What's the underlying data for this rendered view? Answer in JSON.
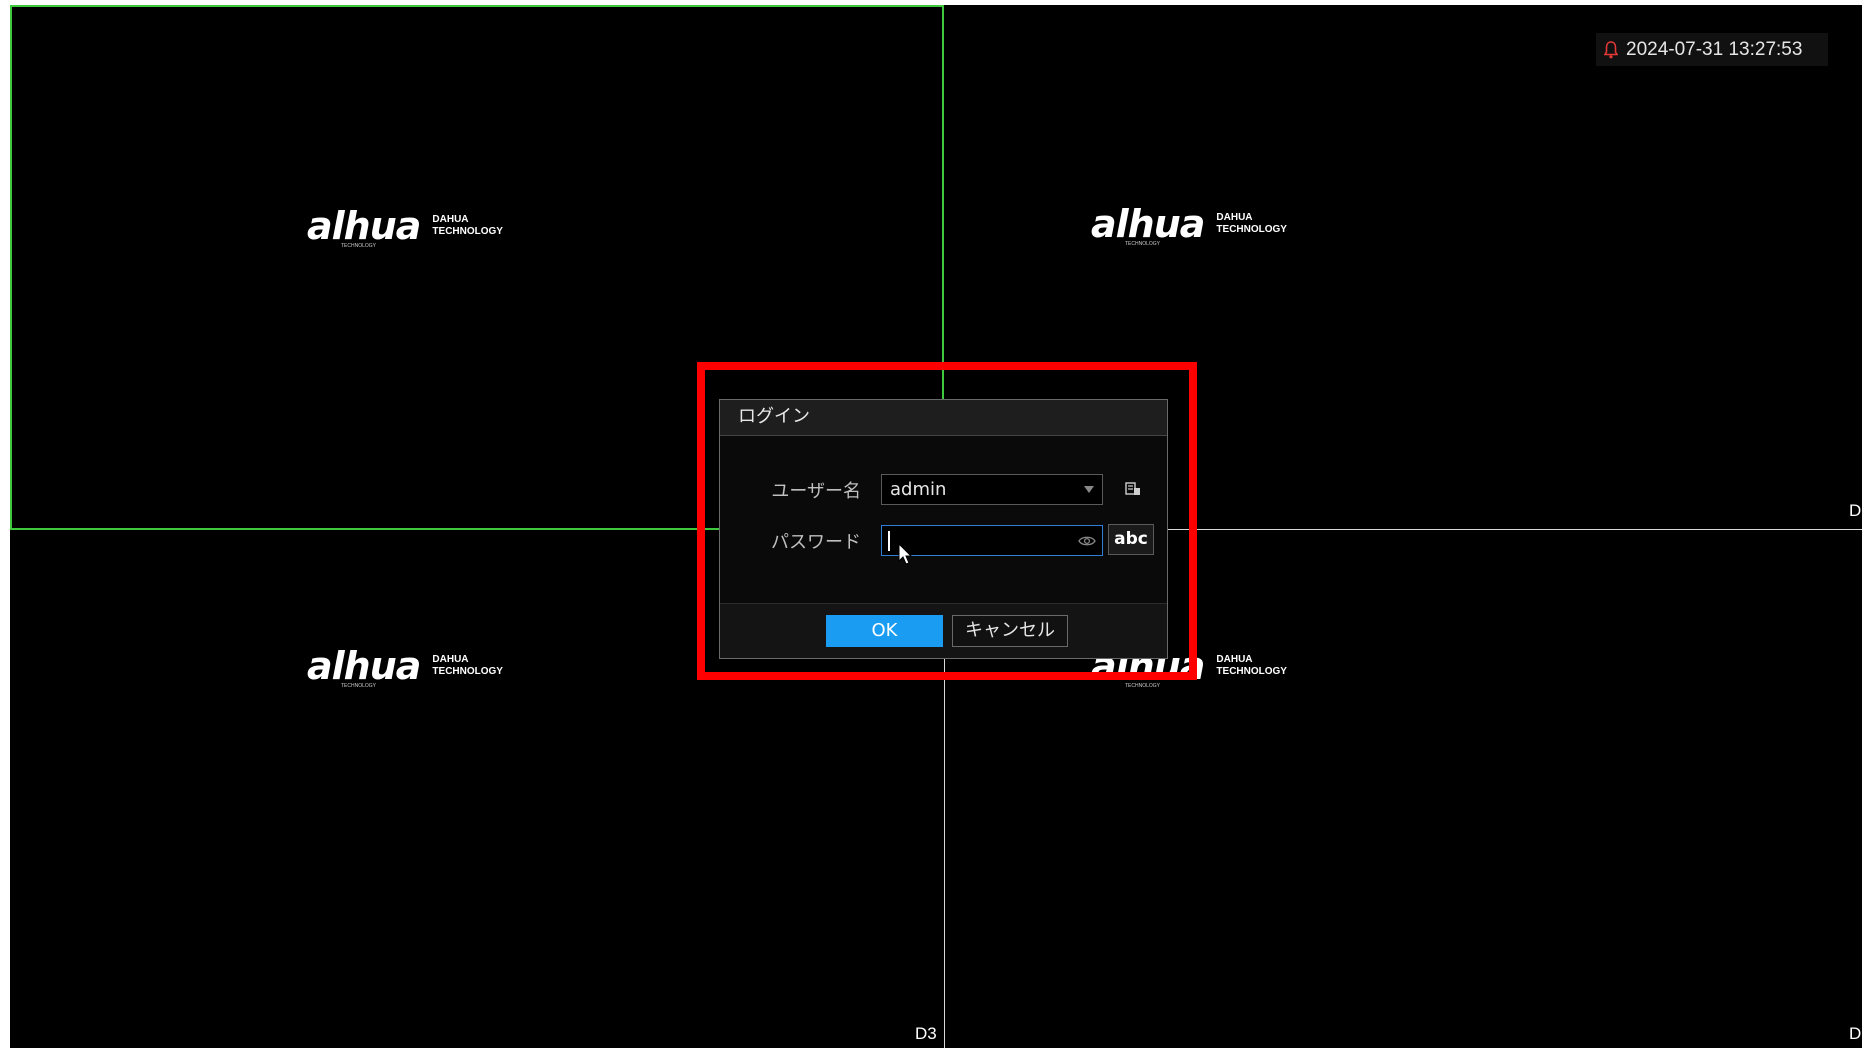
{
  "status_bar": {
    "datetime": "2024-07-31 13:27:53",
    "alarm_icon": "bell-icon",
    "alarm_color": "#e53935"
  },
  "video_grid": {
    "cells": [
      {
        "brand": "alhua",
        "sub_line1": "DAHUA",
        "sub_line2": "TECHNOLOGY",
        "tiny": "TECHNOLOGY",
        "channel": "",
        "selected": true
      },
      {
        "brand": "alhua",
        "sub_line1": "DAHUA",
        "sub_line2": "TECHNOLOGY",
        "tiny": "TECHNOLOGY",
        "channel": "D",
        "selected": false
      },
      {
        "brand": "alhua",
        "sub_line1": "DAHUA",
        "sub_line2": "TECHNOLOGY",
        "tiny": "TECHNOLOGY",
        "channel": "D3",
        "selected": false
      },
      {
        "brand": "alhua",
        "sub_line1": "DAHUA",
        "sub_line2": "TECHNOLOGY",
        "tiny": "TECHNOLOGY",
        "channel": "D",
        "selected": false
      }
    ],
    "selected_border_color": "#3ec83e"
  },
  "login_dialog": {
    "title": "ログイン",
    "username_label": "ユーザー名",
    "username_value": "admin",
    "password_label": "パスワード",
    "password_value": "",
    "input_mode_label": "abc",
    "ok_label": "OK",
    "cancel_label": "キャンセル",
    "accent_color": "#1a9cf2",
    "highlight_color": "#ff0000"
  }
}
